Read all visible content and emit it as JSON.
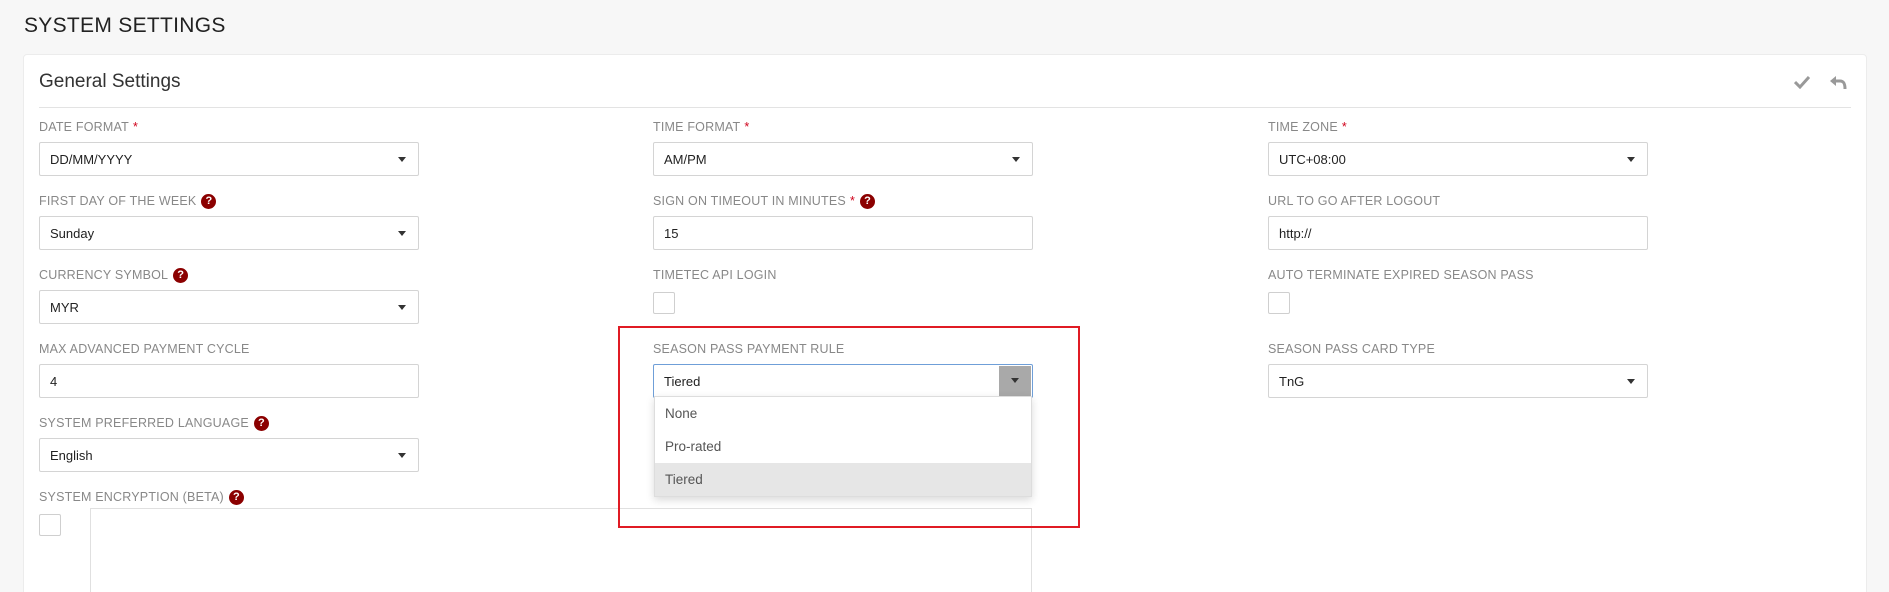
{
  "page": {
    "title": "SYSTEM SETTINGS"
  },
  "panel": {
    "title": "General Settings",
    "actions": {
      "save_icon": "check-icon",
      "undo_icon": "undo-icon"
    }
  },
  "fields": {
    "date_format": {
      "label": "DATE FORMAT",
      "required": "*",
      "value": "DD/MM/YYYY"
    },
    "time_format": {
      "label": "TIME FORMAT",
      "required": "*",
      "value": "AM/PM"
    },
    "time_zone": {
      "label": "TIME ZONE",
      "required": "*",
      "value": "UTC+08:00"
    },
    "first_day": {
      "label": "FIRST DAY OF THE WEEK",
      "value": "Sunday"
    },
    "sign_on_timeout": {
      "label": "SIGN ON TIMEOUT IN MINUTES",
      "required": "*",
      "value": "15"
    },
    "logout_url": {
      "label": "URL TO GO AFTER LOGOUT",
      "value": "http://"
    },
    "currency_symbol": {
      "label": "CURRENCY SYMBOL",
      "value": "MYR"
    },
    "timetec_api_login": {
      "label": "TIMETEC API LOGIN"
    },
    "auto_terminate": {
      "label": "AUTO TERMINATE EXPIRED SEASON PASS"
    },
    "max_payment_cycle": {
      "label": "MAX ADVANCED PAYMENT CYCLE",
      "value": "4"
    },
    "season_pass_rule": {
      "label": "SEASON PASS PAYMENT RULE",
      "value": "Tiered",
      "options": [
        "None",
        "Pro-rated",
        "Tiered"
      ],
      "selected_index": 2
    },
    "season_pass_card": {
      "label": "SEASON PASS CARD TYPE",
      "value": "TnG"
    },
    "preferred_language": {
      "label": "SYSTEM PREFERRED LANGUAGE",
      "value": "English"
    },
    "encryption": {
      "label": "SYSTEM ENCRYPTION (BETA)"
    }
  },
  "help_glyph": "?",
  "colors": {
    "required": "#d0021b",
    "help": "#8b0000",
    "highlight": "#e01b24",
    "focus": "#6f9fd8"
  }
}
